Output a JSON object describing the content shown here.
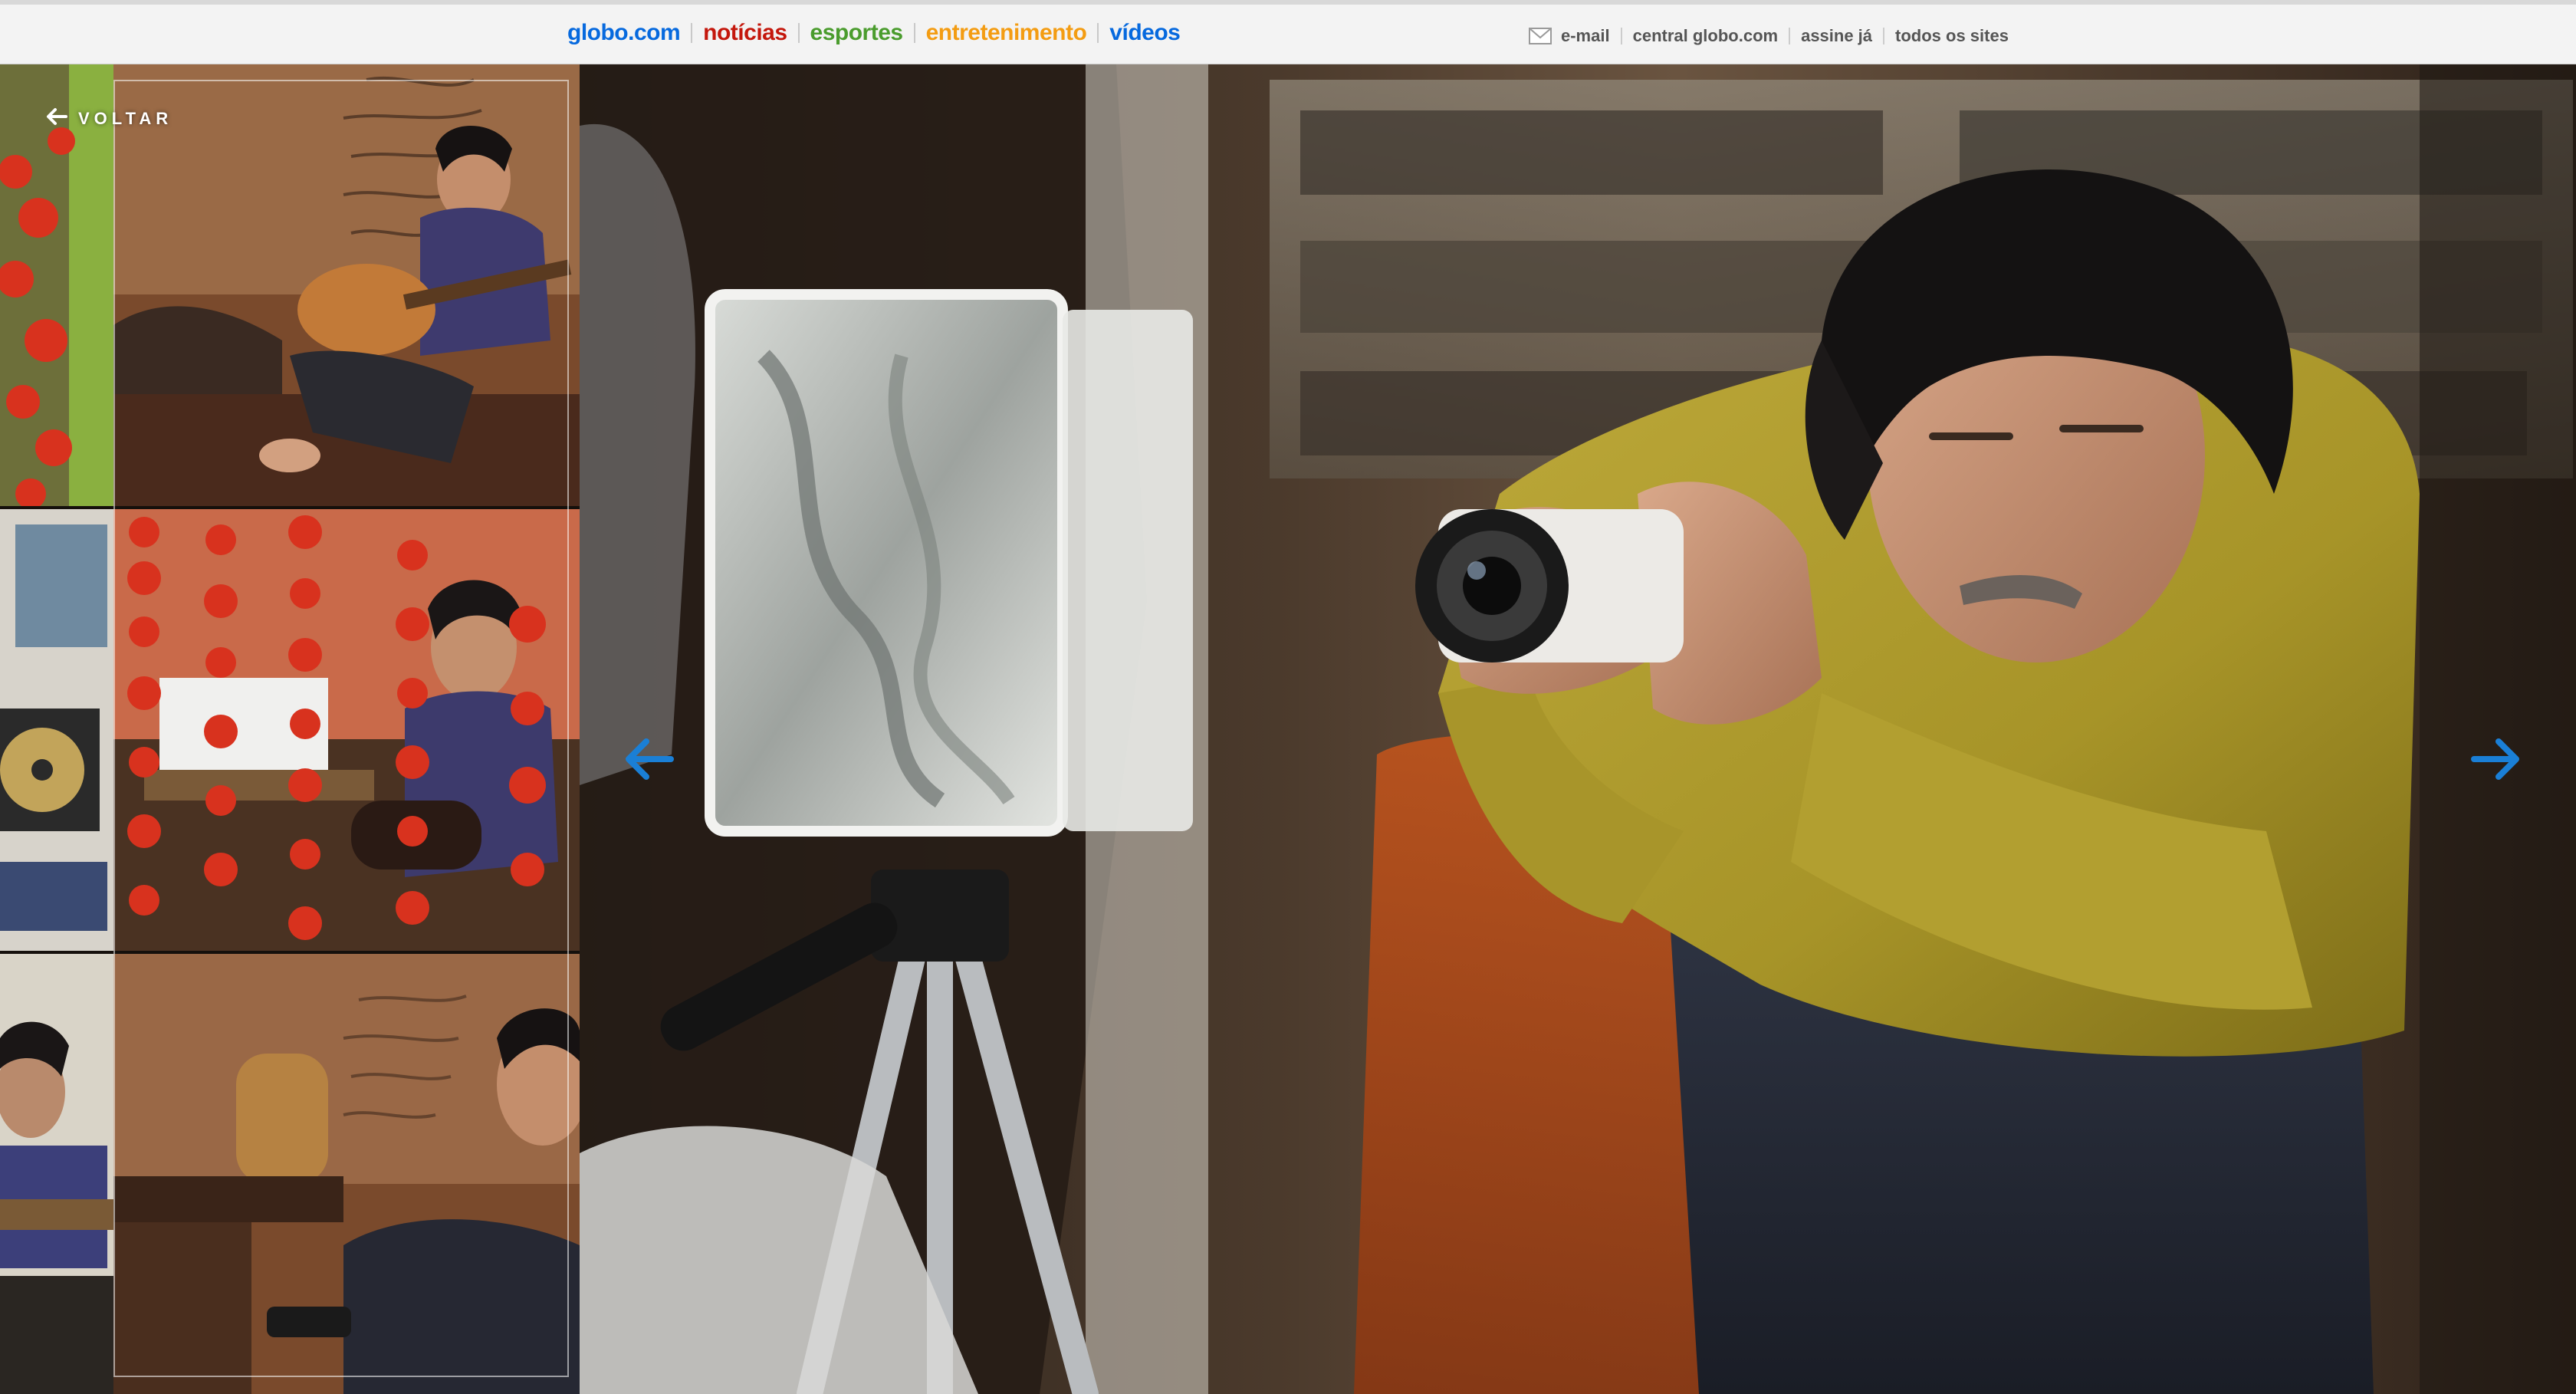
{
  "header": {
    "brand": "globo.com",
    "sections": [
      {
        "label": "notícias",
        "color": "#c4170c"
      },
      {
        "label": "esportes",
        "color": "#4a9c2d"
      },
      {
        "label": "entretenimento",
        "color": "#f39c12"
      },
      {
        "label": "vídeos",
        "color": "#0669de"
      }
    ],
    "user_links": {
      "email": "e-mail",
      "central": "central globo.com",
      "assine": "assine já",
      "todos": "todos os sites"
    },
    "mail_icon": "envelope-icon"
  },
  "gallery": {
    "back_label": "VOLTAR",
    "back_icon": "arrow-left-icon",
    "prev_icon": "arrow-left-icon",
    "next_icon": "arrow-right-icon",
    "accent_color": "#1a7fd6",
    "thumbnail_count": 6
  }
}
